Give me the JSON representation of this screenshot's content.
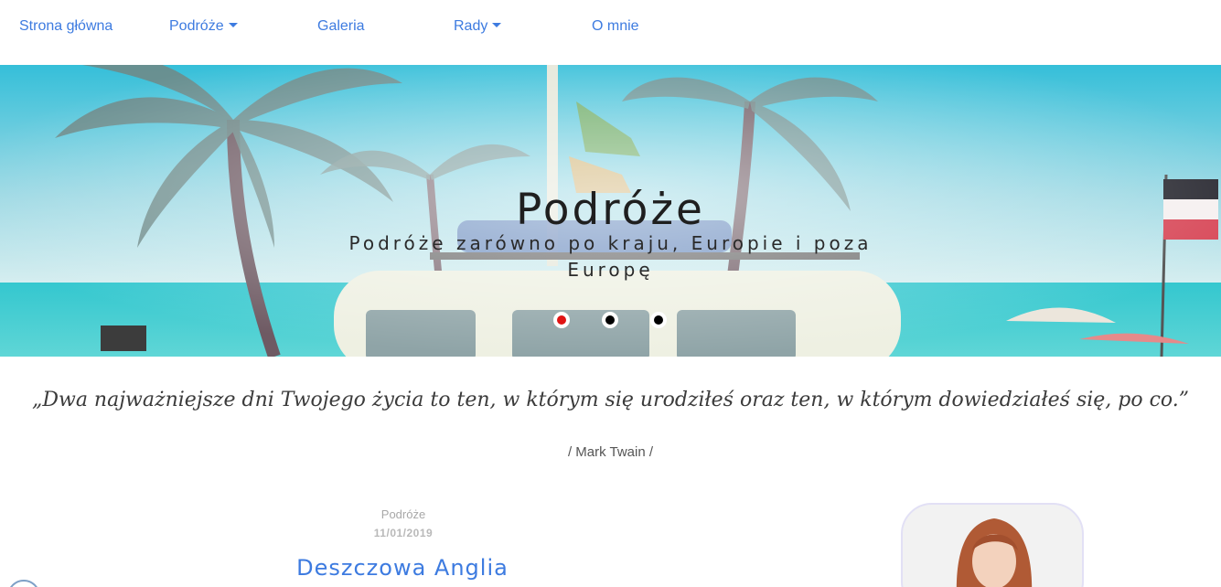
{
  "nav": {
    "items": [
      {
        "label": "Strona główna",
        "has_dropdown": false
      },
      {
        "label": "Podróże",
        "has_dropdown": true
      },
      {
        "label": "Galeria",
        "has_dropdown": false
      },
      {
        "label": "Rady",
        "has_dropdown": true
      },
      {
        "label": "O mnie",
        "has_dropdown": false
      }
    ],
    "color": "#3d7be0"
  },
  "hero": {
    "title": "Podróże",
    "subtitle": "Podróże zarówno po kraju, Europie i poza Europę",
    "slides": {
      "count": 3,
      "active": 1
    },
    "colors": {
      "active_dot": "#e01414",
      "dot": "#000000"
    }
  },
  "quote": {
    "text": "„Dwa najważniejsze dni Twojego życia to ten, w którym się urodziłeś oraz ten, w którym dowiedziałeś się, po co.”",
    "author": "/ Mark Twain /"
  },
  "post": {
    "category": "Podróże",
    "date": "11/01/2019",
    "title": "Deszczowa Anglia"
  }
}
